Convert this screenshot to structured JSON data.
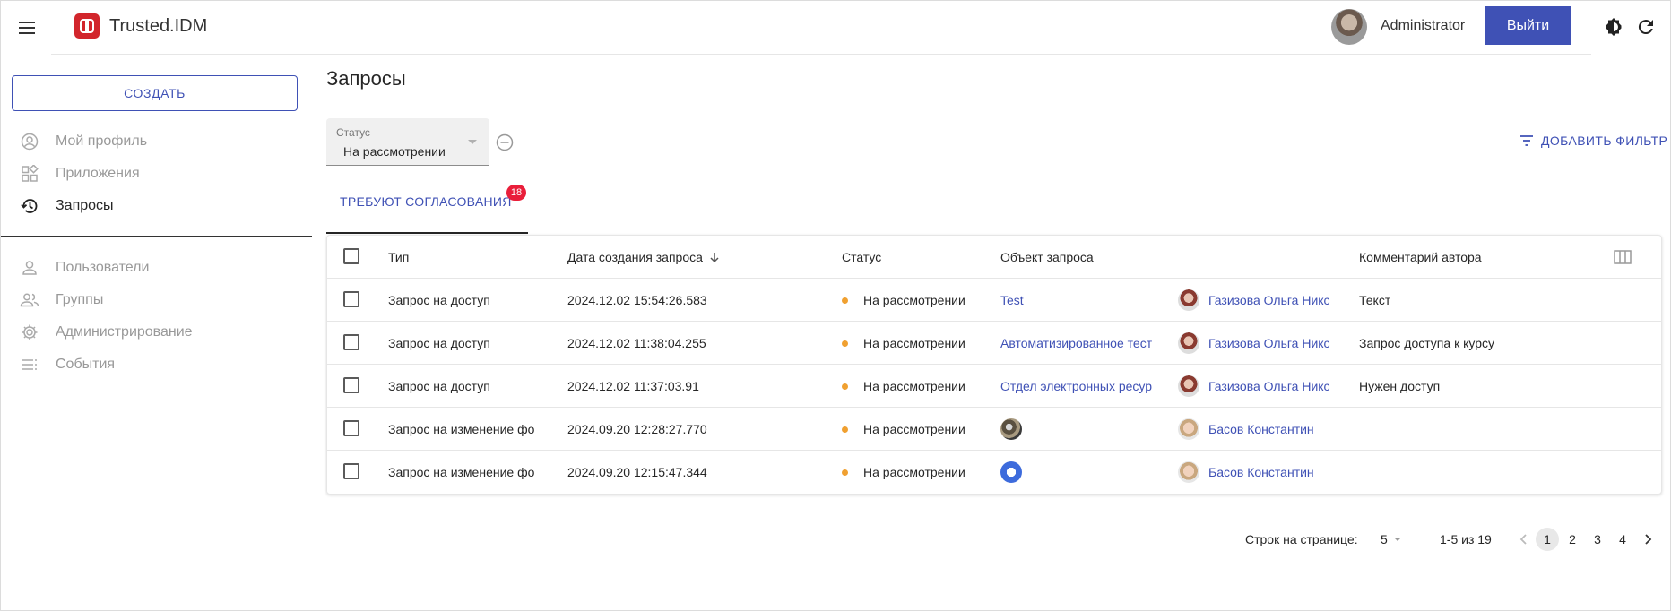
{
  "app": {
    "title": "Trusted.IDM"
  },
  "header": {
    "user_name": "Administrator",
    "logout_label": "Выйти"
  },
  "sidebar": {
    "create_label": "СОЗДАТЬ",
    "items": [
      {
        "label": "Мой профиль",
        "icon": "account-circle-icon"
      },
      {
        "label": "Приложения",
        "icon": "apps-icon"
      },
      {
        "label": "Запросы",
        "icon": "history-icon"
      },
      {
        "label": "Пользователи",
        "icon": "person-icon"
      },
      {
        "label": "Группы",
        "icon": "group-icon"
      },
      {
        "label": "Администрирование",
        "icon": "gear-icon"
      },
      {
        "label": "События",
        "icon": "list-icon"
      }
    ]
  },
  "main": {
    "title": "Запросы",
    "filter": {
      "label": "Статус",
      "value": "На рассмотрении"
    },
    "add_filter_label": "ДОБАВИТЬ ФИЛЬТР",
    "tab": {
      "label": "ТРЕБУЮТ СОГЛАСОВАНИЯ",
      "badge": "18"
    }
  },
  "table": {
    "columns": [
      "Тип",
      "Дата создания запроса",
      "Статус",
      "Объект запроса",
      "Комментарий автора"
    ],
    "rows": [
      {
        "type": "Запрос на доступ",
        "date": "2024.12.02 15:54:26.583",
        "status": "На рассмотрении",
        "object": "Test",
        "author": "Газизова Ольга Никс",
        "comment": "Текст"
      },
      {
        "type": "Запрос на доступ",
        "date": "2024.12.02 11:38:04.255",
        "status": "На рассмотрении",
        "object": "Автоматизированное тест",
        "author": "Газизова Ольга Никс",
        "comment": "Запрос доступа к курсу"
      },
      {
        "type": "Запрос на доступ",
        "date": "2024.12.02 11:37:03.91",
        "status": "На рассмотрении",
        "object": "Отдел электронных ресур",
        "author": "Газизова Ольга Никс",
        "comment": "Нужен доступ"
      },
      {
        "type": "Запрос на изменение фо",
        "date": "2024.09.20 12:28:27.770",
        "status": "На рассмотрении",
        "object": "",
        "author": "Басов Константин",
        "comment": ""
      },
      {
        "type": "Запрос на изменение фо",
        "date": "2024.09.20 12:15:47.344",
        "status": "На рассмотрении",
        "object": "",
        "author": "Басов Константин",
        "comment": ""
      }
    ],
    "status_color": "#f0a030"
  },
  "pagination": {
    "rows_per_page_label": "Строк на странице:",
    "rows_per_page": "5",
    "range": "1-5 из 19",
    "pages": [
      "1",
      "2",
      "3",
      "4"
    ],
    "current_page": "1"
  },
  "colors": {
    "accent": "#3f51b5",
    "logo": "#d2262c",
    "badge": "#e91e3a"
  }
}
